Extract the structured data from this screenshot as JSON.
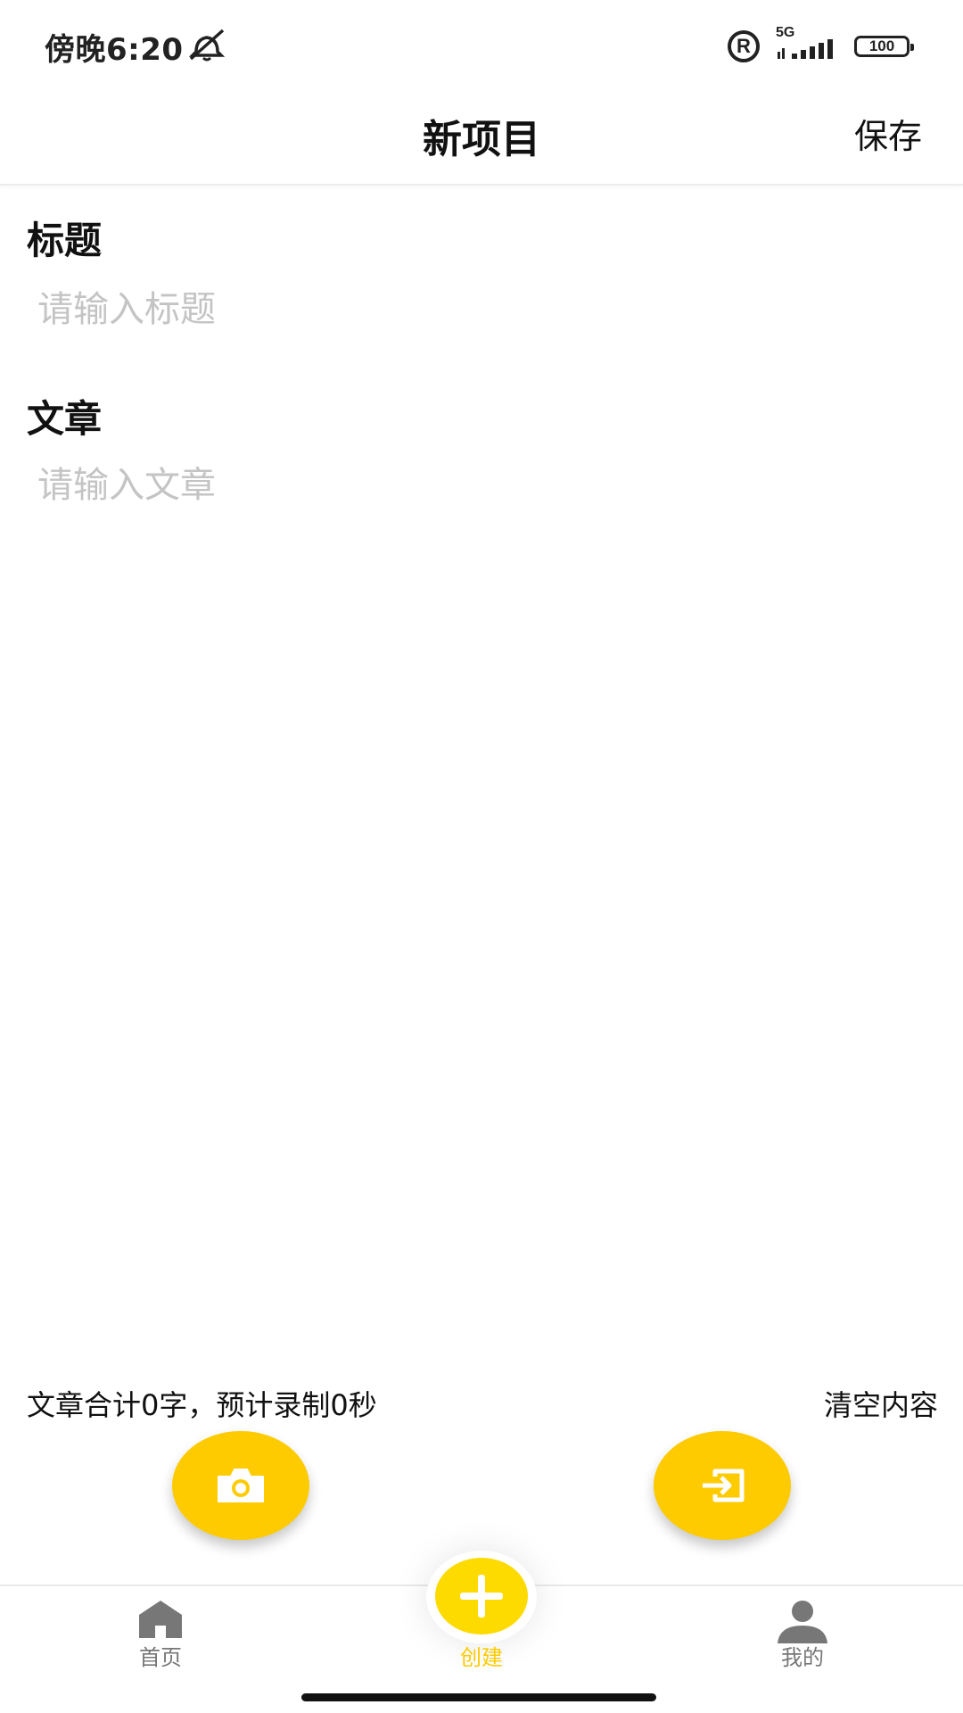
{
  "status_bar": {
    "time": "傍晚6:20",
    "network": "5G",
    "battery": "100",
    "registered_symbol": "R"
  },
  "header": {
    "title": "新项目",
    "save_label": "保存"
  },
  "form": {
    "title_label": "标题",
    "title_placeholder": "请输入标题",
    "article_label": "文章",
    "article_placeholder": "请输入文章"
  },
  "footer_info": {
    "word_count_text": "文章合计0字，预计录制0秒",
    "clear_label": "清空内容"
  },
  "nav": {
    "home_label": "首页",
    "create_label": "创建",
    "mine_label": "我的"
  },
  "colors": {
    "accent": "#FDCB00",
    "placeholder": "#C4C4C4",
    "nav_inactive": "#777777"
  },
  "icons": {
    "camera": "camera-icon",
    "import": "import-icon",
    "home": "home-icon",
    "create": "plus-icon",
    "mine": "person-icon",
    "mute": "mute-vibrate-icon"
  }
}
